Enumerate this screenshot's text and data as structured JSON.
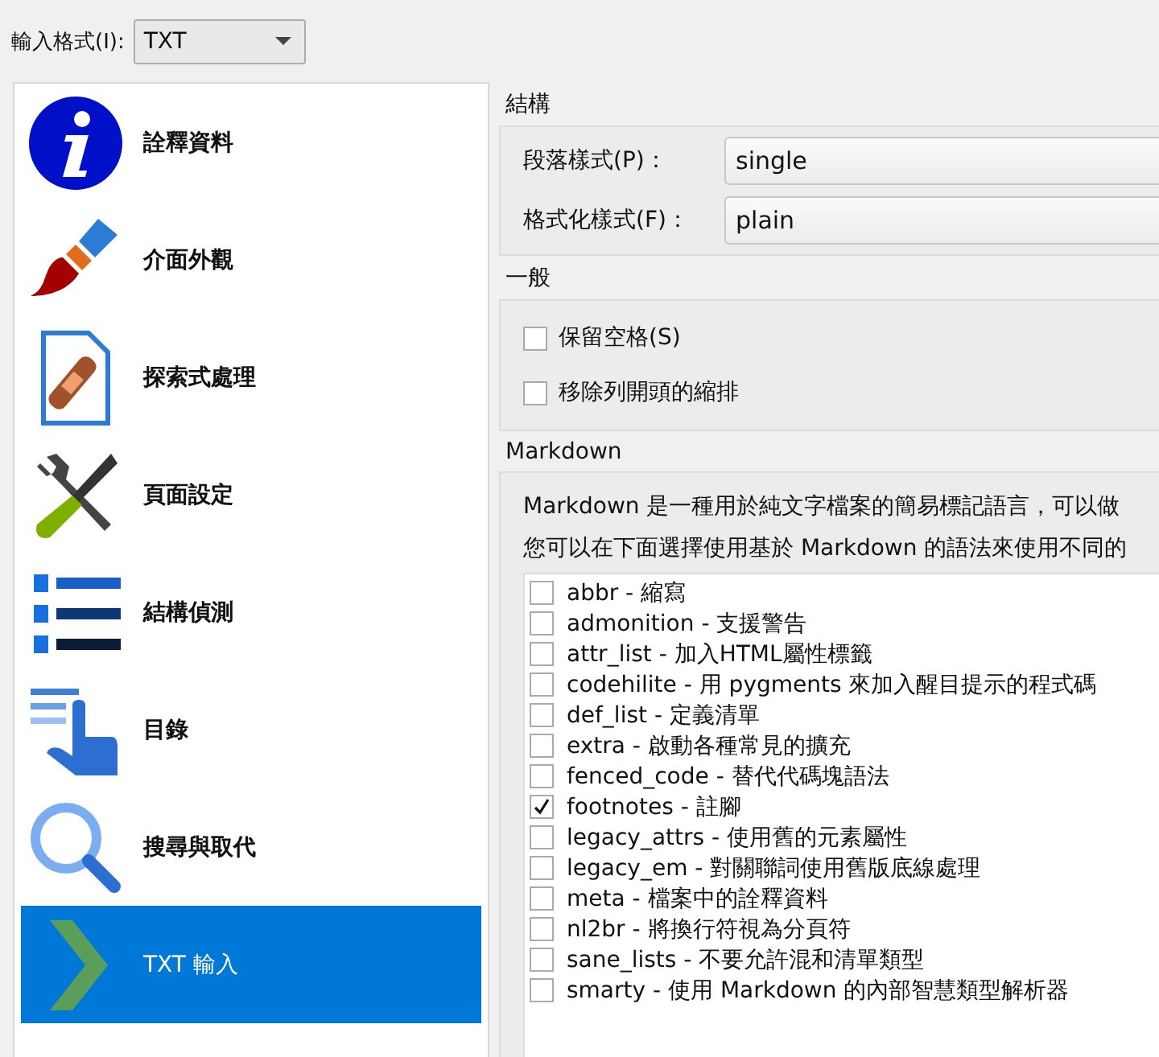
{
  "input_format": {
    "label": "輸入格式(I):",
    "value": "TXT"
  },
  "sidebar": {
    "items": [
      {
        "label": "詮釋資料",
        "selected": false
      },
      {
        "label": "介面外觀",
        "selected": false
      },
      {
        "label": "探索式處理",
        "selected": false
      },
      {
        "label": "頁面設定",
        "selected": false
      },
      {
        "label": "結構偵測",
        "selected": false
      },
      {
        "label": "目錄",
        "selected": false
      },
      {
        "label": "搜尋與取代",
        "selected": false
      },
      {
        "label": "TXT 輸入",
        "selected": true
      }
    ]
  },
  "structure": {
    "title": "結構",
    "fields": [
      {
        "label": "段落樣式(P)：",
        "value": "single"
      },
      {
        "label": "格式化樣式(F)：",
        "value": "plain"
      }
    ]
  },
  "general": {
    "title": "一般",
    "options": [
      {
        "label": "保留空格(S)",
        "checked": false
      },
      {
        "label": "移除列開頭的縮排",
        "checked": false
      }
    ]
  },
  "markdown": {
    "title": "Markdown",
    "description": [
      "Markdown 是一種用於純文字檔案的簡易標記語言，可以做",
      "您可以在下面選擇使用基於 Markdown 的語法來使用不同的"
    ],
    "extensions": [
      {
        "label": "abbr - 縮寫",
        "checked": false
      },
      {
        "label": "admonition - 支援警告",
        "checked": false
      },
      {
        "label": "attr_list - 加入HTML屬性標籤",
        "checked": false
      },
      {
        "label": "codehilite - 用 pygments 來加入醒目提示的程式碼",
        "checked": false
      },
      {
        "label": "def_list - 定義清單",
        "checked": false
      },
      {
        "label": "extra - 啟動各種常見的擴充",
        "checked": false
      },
      {
        "label": "fenced_code - 替代代碼塊語法",
        "checked": false
      },
      {
        "label": "footnotes - 註腳",
        "checked": true
      },
      {
        "label": "legacy_attrs - 使用舊的元素屬性",
        "checked": false
      },
      {
        "label": "legacy_em - 對關聯詞使用舊版底線處理",
        "checked": false
      },
      {
        "label": "meta - 檔案中的詮釋資料",
        "checked": false
      },
      {
        "label": "nl2br - 將換行符視為分頁符",
        "checked": false
      },
      {
        "label": "sane_lists - 不要允許混和清單類型",
        "checked": false
      },
      {
        "label": "smarty - 使用 Markdown 的內部智慧類型解析器",
        "checked": false
      }
    ]
  }
}
